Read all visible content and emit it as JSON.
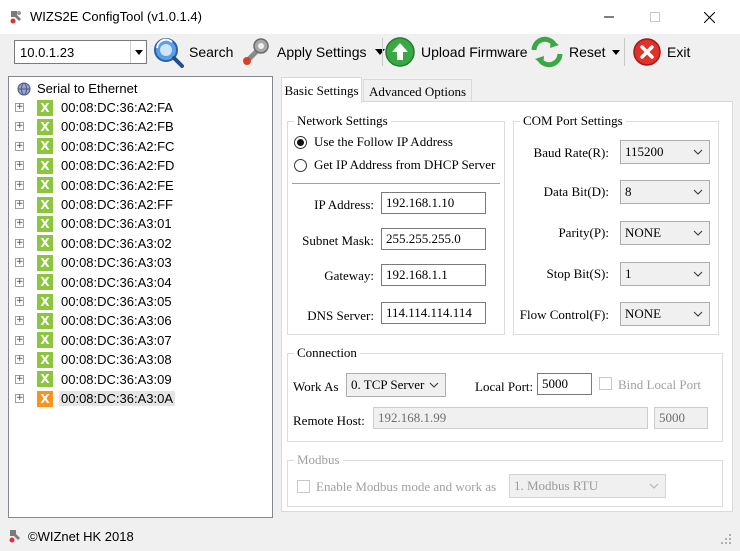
{
  "window": {
    "title": "WIZS2E ConfigTool (v1.0.1.4)",
    "minimize_glyph": "—",
    "close_glyph": "✕"
  },
  "toolbar": {
    "ip_combo_value": "10.0.1.23",
    "search_label": "Search",
    "apply_label": "Apply Settings",
    "upload_label": "Upload Firmware",
    "reset_label": "Reset",
    "exit_label": "Exit"
  },
  "tree": {
    "root_label": "Serial to Ethernet",
    "devices": [
      "00:08:DC:36:A2:FA",
      "00:08:DC:36:A2:FB",
      "00:08:DC:36:A2:FC",
      "00:08:DC:36:A2:FD",
      "00:08:DC:36:A2:FE",
      "00:08:DC:36:A2:FF",
      "00:08:DC:36:A3:01",
      "00:08:DC:36:A3:02",
      "00:08:DC:36:A3:03",
      "00:08:DC:36:A3:04",
      "00:08:DC:36:A3:05",
      "00:08:DC:36:A3:06",
      "00:08:DC:36:A3:07",
      "00:08:DC:36:A3:08",
      "00:08:DC:36:A3:09",
      "00:08:DC:36:A3:0A"
    ]
  },
  "tabs": [
    "Basic Settings",
    "Advanced Options"
  ],
  "network": {
    "group_label": "Network Settings",
    "radio_static": "Use the Follow IP Address",
    "radio_dhcp": "Get IP Address from DHCP Server",
    "ip_label": "IP Address:",
    "ip_value": "192.168.1.10",
    "mask_label": "Subnet Mask:",
    "mask_value": "255.255.255.0",
    "gateway_label": "Gateway:",
    "gateway_value": "192.168.1.1",
    "dns_label": "DNS Server:",
    "dns_value": "114.114.114.114"
  },
  "com": {
    "group_label": "COM Port Settings",
    "baud_label": "Baud Rate(R):",
    "baud_value": "115200",
    "databit_label": "Data Bit(D):",
    "databit_value": "8",
    "parity_label": "Parity(P):",
    "parity_value": "NONE",
    "stopbit_label": "Stop Bit(S):",
    "stopbit_value": "1",
    "flow_label": "Flow Control(F):",
    "flow_value": "NONE"
  },
  "connection": {
    "group_label": "Connection",
    "workas_label": "Work As",
    "workas_value": "0. TCP Server",
    "localport_label": "Local Port:",
    "localport_value": "5000",
    "bind_label": "Bind Local Port",
    "remotehost_label": "Remote Host:",
    "remotehost_value": "192.168.1.99",
    "remoteport_value": "5000"
  },
  "modbus": {
    "group_label": "Modbus",
    "enable_label": "Enable Modbus mode and work as",
    "mode_value": "1. Modbus RTU"
  },
  "status": {
    "text": "©WIZnet HK 2018"
  },
  "colors": {
    "device_icon_green": "#8cc63f",
    "device_icon_orange": "#f7931e",
    "exit_red": "#e0312a",
    "upload_green": "#3aa845"
  }
}
